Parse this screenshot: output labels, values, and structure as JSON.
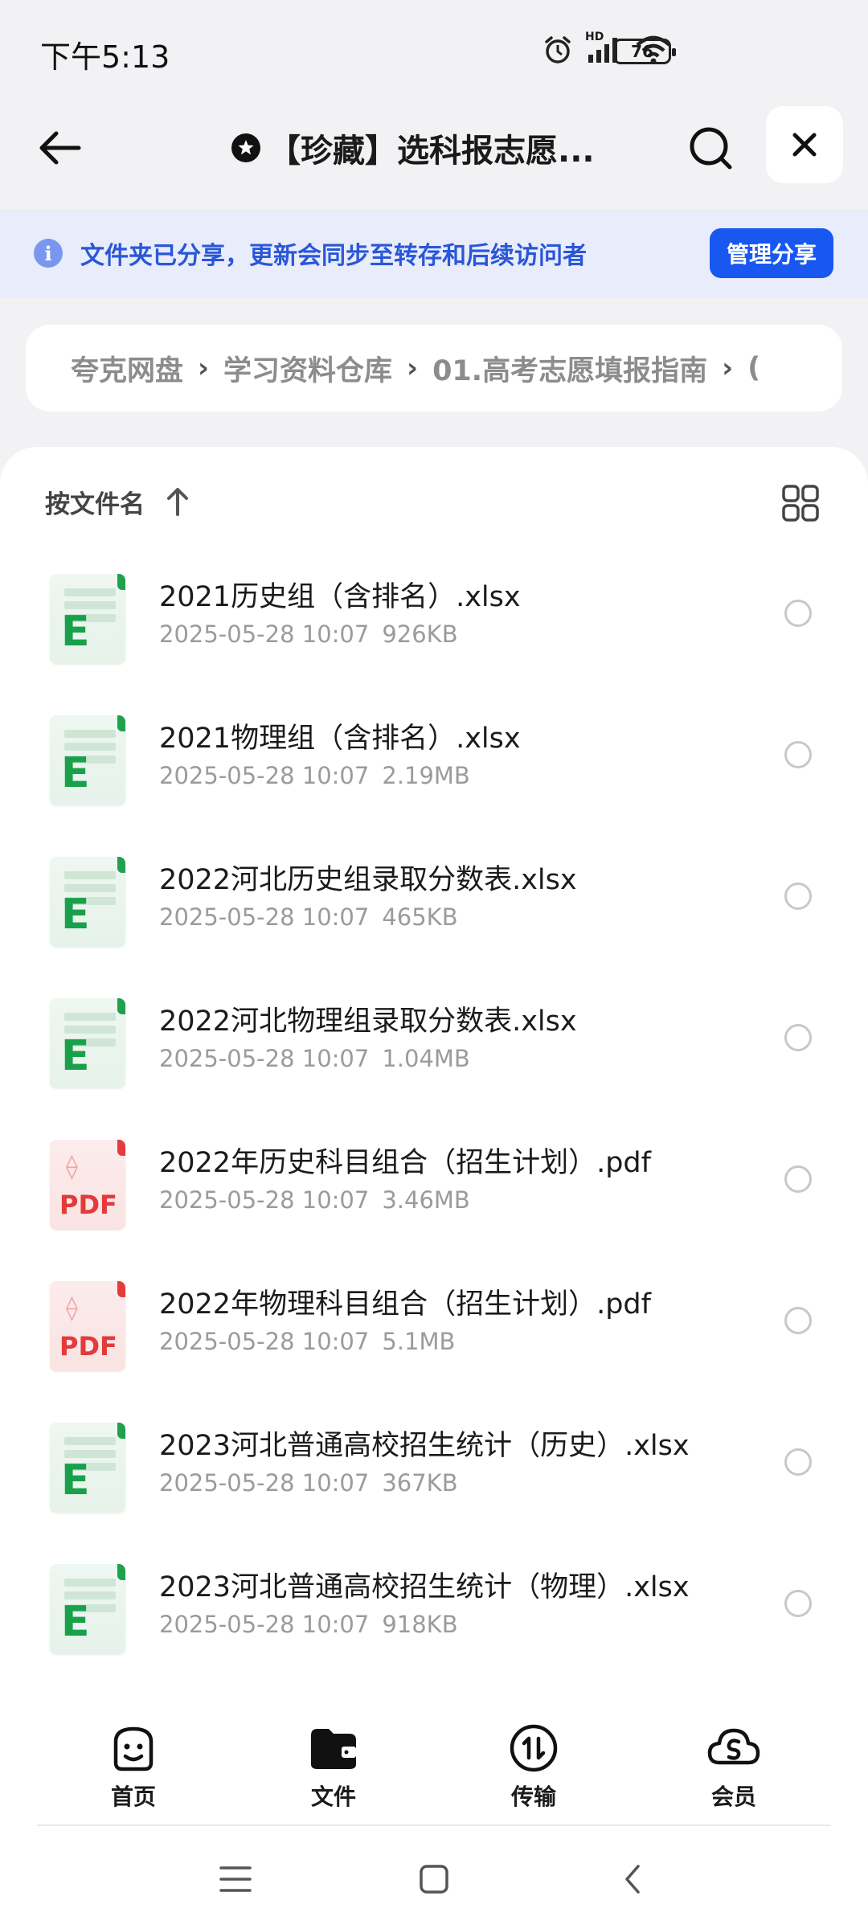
{
  "status_bar": {
    "time": "下午5:13",
    "network_label": "HD",
    "battery": "76"
  },
  "header": {
    "title": "【珍藏】选科报志愿..."
  },
  "share_banner": {
    "text": "文件夹已分享，更新会同步至转存和后续访问者",
    "manage_label": "管理分享"
  },
  "breadcrumb": {
    "items": [
      "夸克网盘",
      "学习资料仓库",
      "01.高考志愿填报指南",
      "("
    ]
  },
  "sort": {
    "label": "按文件名"
  },
  "files": [
    {
      "name": "2021历史组（含排名）.xlsx",
      "date": "2025-05-28 10:07",
      "size": "926KB",
      "type": "xlsx"
    },
    {
      "name": "2021物理组（含排名）.xlsx",
      "date": "2025-05-28 10:07",
      "size": "2.19MB",
      "type": "xlsx"
    },
    {
      "name": "2022河北历史组录取分数表.xlsx",
      "date": "2025-05-28 10:07",
      "size": "465KB",
      "type": "xlsx"
    },
    {
      "name": "2022河北物理组录取分数表.xlsx",
      "date": "2025-05-28 10:07",
      "size": "1.04MB",
      "type": "xlsx"
    },
    {
      "name": "2022年历史科目组合（招生计划）.pdf",
      "date": "2025-05-28 10:07",
      "size": "3.46MB",
      "type": "pdf"
    },
    {
      "name": "2022年物理科目组合（招生计划）.pdf",
      "date": "2025-05-28 10:07",
      "size": "5.1MB",
      "type": "pdf"
    },
    {
      "name": "2023河北普通高校招生统计（历史）.xlsx",
      "date": "2025-05-28 10:07",
      "size": "367KB",
      "type": "xlsx"
    },
    {
      "name": "2023河北普通高校招生统计（物理）.xlsx",
      "date": "2025-05-28 10:07",
      "size": "918KB",
      "type": "xlsx"
    }
  ],
  "icon_labels": {
    "xlsx": "E",
    "pdf": "PDF"
  },
  "bottom_nav": [
    {
      "label": "首页",
      "icon": "smile-face-icon"
    },
    {
      "label": "文件",
      "icon": "folder-icon"
    },
    {
      "label": "传输",
      "icon": "transfer-icon"
    },
    {
      "label": "会员",
      "icon": "cloud-vip-icon"
    }
  ],
  "colors": {
    "accent": "#1858f0",
    "banner_bg": "#e8ecfb",
    "banner_text": "#2a57d8",
    "xlsx_green": "#18a04a",
    "pdf_red": "#e33b3b"
  }
}
